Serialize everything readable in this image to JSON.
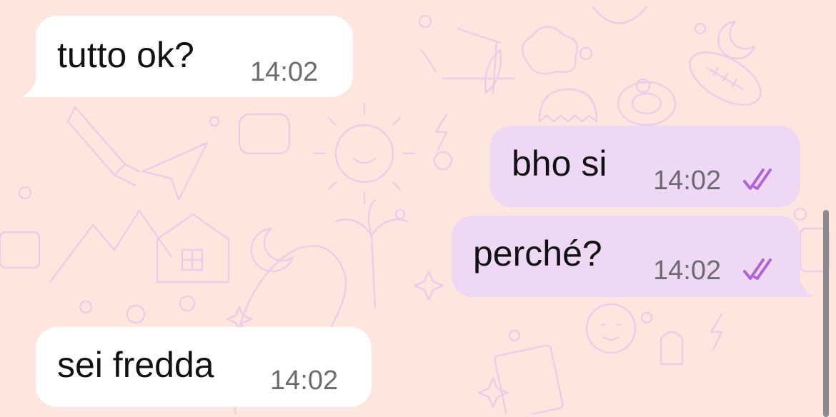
{
  "chat": {
    "messages": [
      {
        "direction": "incoming",
        "text": "tutto ok?",
        "time": "14:02"
      },
      {
        "direction": "outgoing",
        "text": "bho si",
        "time": "14:02",
        "status": "read"
      },
      {
        "direction": "outgoing",
        "text": "perché?",
        "time": "14:02",
        "status": "read"
      },
      {
        "direction": "incoming",
        "text": "sei fredda",
        "time": "14:02"
      }
    ]
  },
  "colors": {
    "wallpaper": "#fde6dd",
    "incoming_bubble": "#ffffff",
    "outgoing_bubble": "#efd8f3",
    "read_ticks": "#b164d3",
    "timestamp": "#6b6b70"
  },
  "icons": {
    "read_status": "double-check-icon"
  }
}
